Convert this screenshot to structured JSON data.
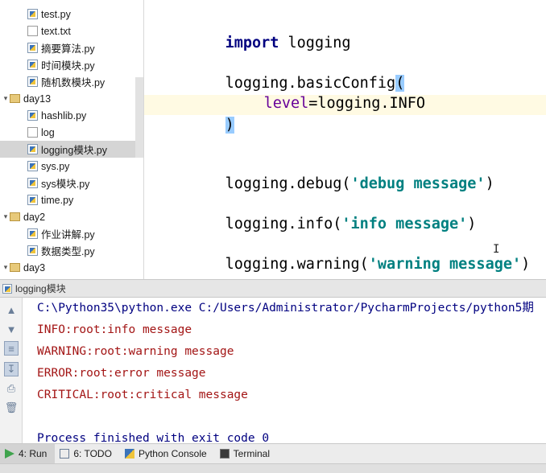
{
  "project_tree": {
    "items": [
      {
        "label": "test.py",
        "type": "py",
        "indent": 1
      },
      {
        "label": "text.txt",
        "type": "txt",
        "indent": 1
      },
      {
        "label": "摘要算法.py",
        "type": "py",
        "indent": 1
      },
      {
        "label": "时间模块.py",
        "type": "py",
        "indent": 1
      },
      {
        "label": "随机数模块.py",
        "type": "py",
        "indent": 1
      },
      {
        "label": "day13",
        "type": "folder",
        "indent": 0
      },
      {
        "label": "hashlib.py",
        "type": "py",
        "indent": 1
      },
      {
        "label": "log",
        "type": "txt",
        "indent": 1
      },
      {
        "label": "logging模块.py",
        "type": "py",
        "indent": 1,
        "selected": true
      },
      {
        "label": "sys.py",
        "type": "py",
        "indent": 1
      },
      {
        "label": "sys模块.py",
        "type": "py",
        "indent": 1
      },
      {
        "label": "time.py",
        "type": "py",
        "indent": 1
      },
      {
        "label": "day2",
        "type": "folder",
        "indent": 0
      },
      {
        "label": "作业讲解.py",
        "type": "py",
        "indent": 1
      },
      {
        "label": "数据类型.py",
        "type": "py",
        "indent": 1
      },
      {
        "label": "day3",
        "type": "folder",
        "indent": 0
      }
    ]
  },
  "editor": {
    "line_import_kw": "import",
    "line_import_mod": " logging",
    "line_basic": "logging.basicConfig",
    "paren_open": "(",
    "kwarg_name": "level",
    "kwarg_value": "=logging.INFO",
    "paren_close": ")",
    "debug_call": "logging.debug(",
    "debug_str": "'debug message'",
    "info_call": "logging.info(",
    "info_str": "'info message'",
    "warning_call": "logging.warning(",
    "warning_str": "'warning message'",
    "close_paren": ")"
  },
  "run_panel": {
    "title": "logging模块",
    "console_lines": [
      {
        "text": "C:\\Python35\\python.exe C:/Users/Administrator/PycharmProjects/python5期",
        "kind": "cmd"
      },
      {
        "text": "INFO:root:info message",
        "kind": "err"
      },
      {
        "text": "WARNING:root:warning message",
        "kind": "err"
      },
      {
        "text": "ERROR:root:error message",
        "kind": "err"
      },
      {
        "text": "CRITICAL:root:critical message",
        "kind": "err"
      },
      {
        "text": "",
        "kind": "blank"
      },
      {
        "text": "Process finished with exit code 0",
        "kind": "exit"
      }
    ]
  },
  "bottom_tabs": {
    "run": "4: Run",
    "todo": "6: TODO",
    "python_console": "Python Console",
    "terminal": "Terminal"
  },
  "icons": {
    "up": "arrow-up-icon",
    "down": "arrow-down-icon",
    "wrap": "soft-wrap-icon",
    "scroll": "scroll-to-end-icon",
    "print": "print-icon",
    "trash": "trash-icon"
  }
}
